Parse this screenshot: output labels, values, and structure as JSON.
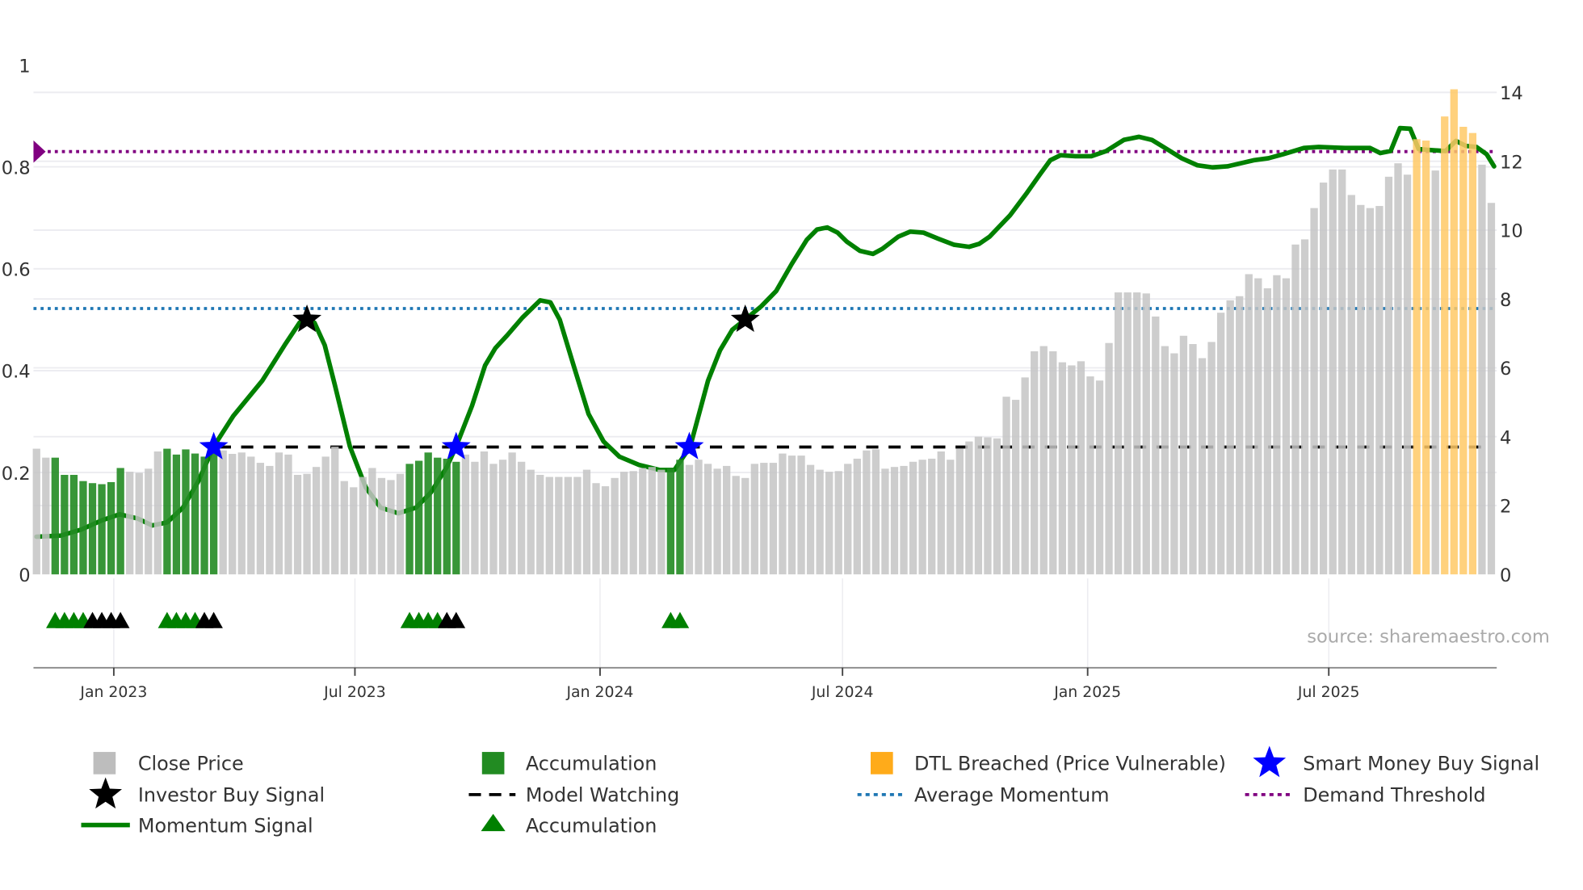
{
  "chart_data": {
    "type": "bar",
    "frequency": "weekly",
    "start_date": "2022-11-04",
    "left_axis": {
      "ylim": [
        0,
        1
      ],
      "ticks": [
        "0",
        "0.2",
        "0.4",
        "0.6",
        "0.8",
        "1"
      ],
      "tick_values": [
        0,
        0.2,
        0.4,
        0.6,
        0.8,
        1
      ]
    },
    "right_axis": {
      "ylim": [
        0,
        14
      ],
      "ticks": [
        "0",
        "2",
        "4",
        "6",
        "8",
        "10",
        "12",
        "14"
      ],
      "tick_values": [
        0,
        2,
        4,
        6,
        8,
        10,
        12,
        14
      ]
    },
    "x_ticks": [
      {
        "date": "2023-01-01",
        "label": "Jan 2023"
      },
      {
        "date": "2023-07-01",
        "label": "Jul 2023"
      },
      {
        "date": "2024-01-01",
        "label": "Jan 2024"
      },
      {
        "date": "2024-07-01",
        "label": "Jul 2024"
      },
      {
        "date": "2025-01-01",
        "label": "Jan 2025"
      },
      {
        "date": "2025-07-01",
        "label": "Jul 2025"
      }
    ],
    "close_price": [
      3.65,
      3.39,
      3.39,
      2.89,
      2.89,
      2.71,
      2.65,
      2.62,
      2.68,
      3.09,
      2.98,
      2.95,
      3.07,
      3.57,
      3.65,
      3.48,
      3.63,
      3.51,
      3.42,
      3.71,
      3.6,
      3.5,
      3.54,
      3.42,
      3.24,
      3.15,
      3.54,
      3.48,
      2.89,
      2.92,
      3.12,
      3.42,
      3.71,
      2.71,
      2.53,
      2.83,
      3.09,
      2.8,
      2.74,
      2.92,
      3.21,
      3.3,
      3.54,
      3.39,
      3.36,
      3.27,
      3.48,
      3.27,
      3.57,
      3.21,
      3.33,
      3.54,
      3.27,
      3.04,
      2.89,
      2.83,
      2.83,
      2.83,
      2.83,
      3.04,
      2.65,
      2.56,
      2.8,
      2.98,
      3.0,
      3.09,
      3.12,
      3.04,
      3.07,
      3.33,
      3.18,
      3.33,
      3.21,
      3.07,
      3.15,
      2.86,
      2.8,
      3.21,
      3.24,
      3.24,
      3.51,
      3.45,
      3.45,
      3.18,
      3.04,
      2.98,
      3.0,
      3.21,
      3.36,
      3.6,
      3.63,
      3.07,
      3.12,
      3.15,
      3.27,
      3.33,
      3.36,
      3.57,
      3.33,
      3.65,
      3.86,
      4.0,
      3.98,
      3.95,
      5.16,
      5.07,
      5.72,
      6.48,
      6.63,
      6.48,
      6.16,
      6.07,
      6.19,
      5.75,
      5.63,
      6.72,
      8.19,
      8.19,
      8.19,
      8.16,
      7.49,
      6.63,
      6.42,
      6.93,
      6.69,
      6.28,
      6.75,
      7.6,
      7.96,
      8.08,
      8.72,
      8.6,
      8.31,
      8.69,
      8.6,
      9.58,
      9.73,
      10.64,
      11.38,
      11.76,
      11.76,
      11.02,
      10.73,
      10.64,
      10.7,
      11.55,
      11.94,
      11.61,
      12.64,
      12.6,
      11.73,
      13.3,
      14.09,
      13.0,
      12.82,
      11.9,
      10.79
    ],
    "accumulation_weeks": [
      2,
      3,
      4,
      5,
      6,
      7,
      8,
      9,
      14,
      15,
      16,
      17,
      18,
      19,
      40,
      41,
      42,
      43,
      44,
      45,
      68,
      69
    ],
    "dtl_breached_weeks": [
      148,
      149,
      151,
      152,
      153,
      154
    ],
    "momentum_signal": [
      [
        0,
        0.074
      ],
      [
        2.6,
        0.076
      ],
      [
        4.8,
        0.088
      ],
      [
        7.0,
        0.106
      ],
      [
        8.9,
        0.118
      ],
      [
        10.8,
        0.11
      ],
      [
        12.4,
        0.096
      ],
      [
        14.0,
        0.102
      ],
      [
        15.7,
        0.131
      ],
      [
        17.3,
        0.181
      ],
      [
        19.0,
        0.251
      ],
      [
        21.1,
        0.311
      ],
      [
        24.2,
        0.38
      ],
      [
        26.6,
        0.45
      ],
      [
        28.2,
        0.494
      ],
      [
        29.1,
        0.502
      ],
      [
        29.8,
        0.494
      ],
      [
        30.9,
        0.45
      ],
      [
        32.0,
        0.371
      ],
      [
        33.6,
        0.251
      ],
      [
        35.3,
        0.171
      ],
      [
        36.9,
        0.131
      ],
      [
        38.8,
        0.12
      ],
      [
        40.7,
        0.131
      ],
      [
        42.3,
        0.161
      ],
      [
        44.0,
        0.211
      ],
      [
        45.0,
        0.251
      ],
      [
        46.7,
        0.331
      ],
      [
        48.1,
        0.41
      ],
      [
        49.2,
        0.444
      ],
      [
        50.5,
        0.47
      ],
      [
        52.1,
        0.504
      ],
      [
        54.0,
        0.538
      ],
      [
        55.1,
        0.534
      ],
      [
        56.1,
        0.5
      ],
      [
        57.6,
        0.41
      ],
      [
        59.2,
        0.315
      ],
      [
        60.8,
        0.261
      ],
      [
        62.5,
        0.231
      ],
      [
        64.6,
        0.215
      ],
      [
        66.8,
        0.205
      ],
      [
        68.4,
        0.205
      ],
      [
        70.1,
        0.251
      ],
      [
        72.0,
        0.38
      ],
      [
        73.3,
        0.44
      ],
      [
        74.6,
        0.48
      ],
      [
        76.1,
        0.502
      ],
      [
        77.7,
        0.526
      ],
      [
        79.3,
        0.556
      ],
      [
        81.0,
        0.61
      ],
      [
        82.6,
        0.657
      ],
      [
        83.7,
        0.677
      ],
      [
        84.8,
        0.681
      ],
      [
        85.9,
        0.671
      ],
      [
        86.9,
        0.653
      ],
      [
        88.3,
        0.635
      ],
      [
        89.7,
        0.629
      ],
      [
        90.7,
        0.639
      ],
      [
        92.4,
        0.663
      ],
      [
        93.7,
        0.673
      ],
      [
        95.1,
        0.671
      ],
      [
        96.7,
        0.659
      ],
      [
        98.4,
        0.647
      ],
      [
        100.0,
        0.643
      ],
      [
        101.1,
        0.649
      ],
      [
        102.2,
        0.663
      ],
      [
        104.4,
        0.705
      ],
      [
        106.2,
        0.749
      ],
      [
        107.6,
        0.785
      ],
      [
        108.7,
        0.813
      ],
      [
        109.8,
        0.823
      ],
      [
        111.4,
        0.821
      ],
      [
        113.1,
        0.821
      ],
      [
        114.7,
        0.831
      ],
      [
        116.6,
        0.853
      ],
      [
        118.2,
        0.859
      ],
      [
        119.6,
        0.853
      ],
      [
        121.2,
        0.835
      ],
      [
        122.8,
        0.817
      ],
      [
        124.5,
        0.803
      ],
      [
        126.1,
        0.799
      ],
      [
        127.7,
        0.801
      ],
      [
        130.5,
        0.813
      ],
      [
        132.1,
        0.817
      ],
      [
        133.7,
        0.825
      ],
      [
        135.9,
        0.837
      ],
      [
        137.5,
        0.839
      ],
      [
        140.3,
        0.837
      ],
      [
        143.0,
        0.837
      ],
      [
        144.1,
        0.827
      ],
      [
        145.2,
        0.831
      ],
      [
        146.2,
        0.876
      ],
      [
        147.3,
        0.875
      ],
      [
        148.2,
        0.835
      ],
      [
        149.5,
        0.833
      ],
      [
        151.1,
        0.831
      ],
      [
        152.2,
        0.851
      ],
      [
        153.3,
        0.841
      ],
      [
        154.4,
        0.839
      ],
      [
        155.5,
        0.825
      ],
      [
        156.3,
        0.801
      ]
    ],
    "average_momentum": 0.522,
    "demand_threshold": 0.83,
    "model_watching": {
      "value": 0.25,
      "from_week": 19
    },
    "smart_money_buy_signals": [
      {
        "week": 19,
        "value": 0.25
      },
      {
        "week": 45,
        "value": 0.25
      },
      {
        "week": 70,
        "value": 0.25
      }
    ],
    "investor_buy_signals": [
      {
        "week": 29,
        "value": 0.5
      },
      {
        "week": 76,
        "value": 0.5
      }
    ],
    "accumulation_markers_green": [
      2,
      3,
      4,
      5,
      14,
      15,
      16,
      17,
      40,
      41,
      42,
      43,
      68,
      69
    ],
    "accumulation_markers_black": [
      6,
      7,
      8,
      9,
      18,
      19,
      44,
      45
    ],
    "source": "source: sharemaestro.com",
    "legend": {
      "placement": "bottom",
      "items": [
        {
          "label": "Close Price"
        },
        {
          "label": "Accumulation"
        },
        {
          "label": "DTL Breached (Price Vulnerable)"
        },
        {
          "label": "Smart Money Buy Signal"
        },
        {
          "label": "Investor Buy Signal"
        },
        {
          "label": "Model Watching"
        },
        {
          "label": "Average Momentum"
        },
        {
          "label": "Demand Threshold"
        },
        {
          "label": "Momentum Signal"
        },
        {
          "label": "Accumulation"
        }
      ]
    },
    "colors": {
      "close": "#c4c4c4",
      "accumulation": "#228b22",
      "dtl": "#ffc966",
      "momentum": "#008000",
      "avg_momentum": "#1f77b4",
      "demand": "#800080",
      "smart_money": "#0000ff",
      "investor": "#000000",
      "grid": "#ececf0"
    }
  }
}
